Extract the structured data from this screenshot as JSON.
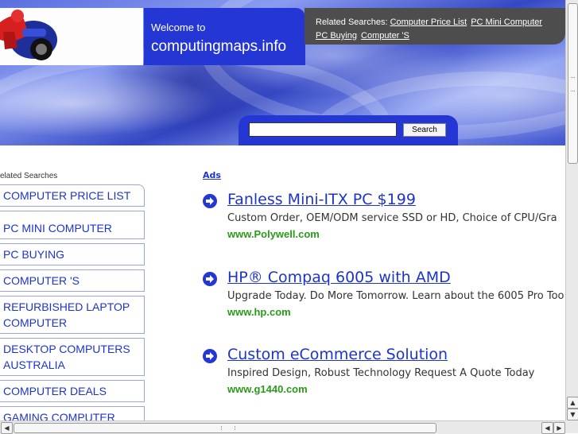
{
  "header": {
    "welcome_line1": "Welcome to",
    "welcome_line2": "computingmaps.info",
    "related_label": "Related Searches:",
    "related_links": [
      "Computer Price List",
      "PC Mini Computer",
      "PC Buying",
      "Computer 'S"
    ],
    "search_input_value": "",
    "search_button_label": "Search"
  },
  "sidebar": {
    "title": "elated Searches",
    "items": [
      "COMPUTER PRICE LIST",
      "PC MINI COMPUTER",
      "PC BUYING",
      "COMPUTER 'S",
      "REFURBISHED LAPTOP COMPUTER",
      "DESKTOP COMPUTERS AUSTRALIA",
      "COMPUTER DEALS",
      "GAMING COMPUTER"
    ]
  },
  "ads": {
    "label": "Ads",
    "items": [
      {
        "title": "Fanless Mini-ITX PC $199",
        "desc": "Custom Order, OEM/ODM service SSD or HD, Choice of CPU/Gra",
        "url": "www.Polywell.com"
      },
      {
        "title": "HP® Compaq 6005 with AMD",
        "desc": "Upgrade Today. Do More Tomorrow. Learn about the 6005 Pro Too",
        "url": "www.hp.com"
      },
      {
        "title": "Custom eCommerce Solution",
        "desc": "Inspired Design, Robust Technology Request A Quote Today",
        "url": "www.g1440.com"
      }
    ]
  },
  "colors": {
    "brand_blue": "#2436d4",
    "link_blue": "#1d34cc",
    "url_green": "#2a9a1a",
    "related_bg": "#4d4d4d"
  },
  "icons": {
    "ad_bullet": "arrow-right-circle-icon",
    "logo": "motorcycle-rider-icon"
  }
}
